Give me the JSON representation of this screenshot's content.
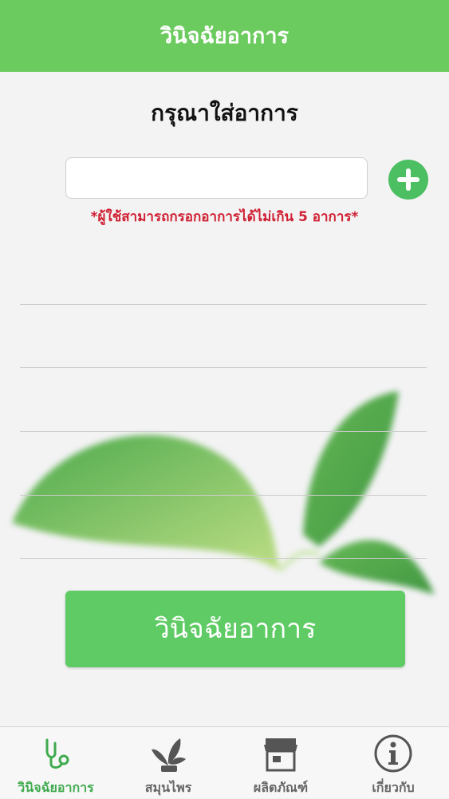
{
  "header": {
    "title": "วินิจฉัยอาการ"
  },
  "form": {
    "prompt": "กรุณาใส่อาการ",
    "input_value": "",
    "input_placeholder": "",
    "add_icon": "plus-circle-icon",
    "warning": "*ผู้ใช้สามารถกรอกอาการได้ไม่เกิน 5 อาการ*"
  },
  "symptom_list": {
    "rows": 5
  },
  "actions": {
    "diagnose_label": "วินิจฉัยอาการ"
  },
  "tabbar": {
    "tabs": [
      {
        "label": "วินิจฉัยอาการ",
        "icon": "stethoscope-icon",
        "active": true
      },
      {
        "label": "สมุนไพร",
        "icon": "herb-plant-icon",
        "active": false
      },
      {
        "label": "ผลิตภัณฑ์",
        "icon": "shop-icon",
        "active": false
      },
      {
        "label": "เกี่ยวกับ",
        "icon": "info-icon",
        "active": false
      }
    ]
  },
  "colors": {
    "header": "#6ccb5f",
    "accent": "#4cbf62",
    "warning": "#d02032",
    "active_tab": "#3faa4e",
    "inactive_tab": "#666666"
  }
}
